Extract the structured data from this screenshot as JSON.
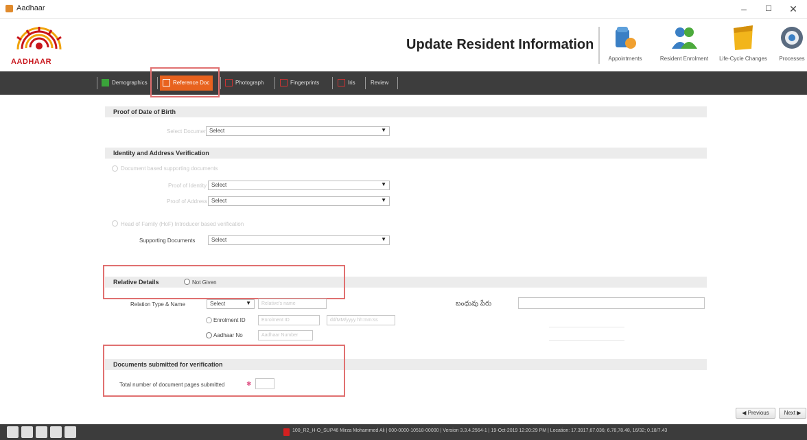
{
  "window": {
    "title": "Aadhaar",
    "minimize": "–",
    "maximize": "☐",
    "close": "✕"
  },
  "header": {
    "logo_text": "AADHAAR",
    "title": "Update Resident Information",
    "icons": [
      {
        "label": "Appointments",
        "icon": "appointments-icon"
      },
      {
        "label": "Resident Enrolment",
        "icon": "resident-enrolment-icon"
      },
      {
        "label": "Life-Cycle Changes",
        "icon": "life-cycle-changes-icon"
      },
      {
        "label": "Processes",
        "icon": "processes-icon"
      }
    ]
  },
  "tabs": [
    {
      "label": "Demographics",
      "state": "done"
    },
    {
      "label": "Reference Doc",
      "state": "active"
    },
    {
      "label": "Photograph",
      "state": "pending"
    },
    {
      "label": "Fingerprints",
      "state": "pending"
    },
    {
      "label": "Iris",
      "state": "pending"
    },
    {
      "label": "Review",
      "state": "none"
    }
  ],
  "proof_dob": {
    "heading": "Proof of Date of Birth",
    "field_label": "Select Document",
    "value": "Select"
  },
  "identity": {
    "heading": "Identity and Address Verification",
    "option_docs": "Document based supporting documents",
    "poi_label": "Proof of Identity",
    "poi_value": "Select",
    "poa_label": "Proof of Address",
    "poa_value": "Select",
    "option_hof": "Head of Family (HoF) Introducer based verification",
    "supporting_label": "Supporting Documents",
    "supporting_value": "Select"
  },
  "relative": {
    "heading": "Relative Details",
    "not_given": "Not Given",
    "relation_label": "Relation Type & Name",
    "relation_value": "Select",
    "name_placeholder": "Relative's name",
    "local_name_label": "బంధువు పేరు",
    "enrolment_id_label": "Enrolment ID",
    "enrolment_id_placeholder": "Enrolment ID",
    "enrolment_date_placeholder": "dd/MM/yyyy hh:mm:ss",
    "aadhaar_no_label": "Aadhaar No",
    "aadhaar_no_placeholder": "Aadhaar Number"
  },
  "documents": {
    "heading": "Documents submitted for verification",
    "pages_label": "Total number of document pages submitted",
    "required_mark": "✱"
  },
  "nav": {
    "previous": "◀ Previous",
    "next": "Next ▶"
  },
  "status": {
    "text": "100_R2_H-O_SUP46 Mirza Mohammed Ali | 000-0000-10518-00000 | Version 3.3.4.2564-1 | 19-Oct-2019 12:20:29 PM | Location: 17.3917,67.036; 6.78,78.48, 16/32; 0.18/7.43"
  },
  "colors": {
    "tabbar_bg": "#3d3d3d",
    "tab_active": "#e8621e",
    "highlight_border": "#e07070",
    "section_bg": "#ececec"
  }
}
